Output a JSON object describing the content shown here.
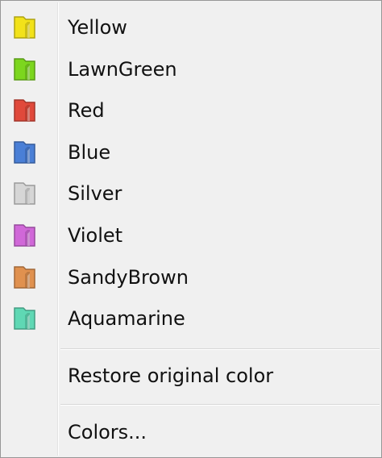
{
  "menu": {
    "color_items": [
      {
        "label": "Yellow",
        "icon": "folder-color-icon",
        "color": "#f2e21a"
      },
      {
        "label": "LawnGreen",
        "icon": "folder-color-icon",
        "color": "#7cd61e"
      },
      {
        "label": "Red",
        "icon": "folder-color-icon",
        "color": "#e0493b"
      },
      {
        "label": "Blue",
        "icon": "folder-color-icon",
        "color": "#4a7fd6"
      },
      {
        "label": "Silver",
        "icon": "folder-color-icon",
        "color": "#d6d6d6"
      },
      {
        "label": "Violet",
        "icon": "folder-color-icon",
        "color": "#d068d8"
      },
      {
        "label": "SandyBrown",
        "icon": "folder-color-icon",
        "color": "#e0914f"
      },
      {
        "label": "Aquamarine",
        "icon": "folder-color-icon",
        "color": "#5fd8b4"
      }
    ],
    "restore_label": "Restore original color",
    "colors_label": "Colors..."
  }
}
